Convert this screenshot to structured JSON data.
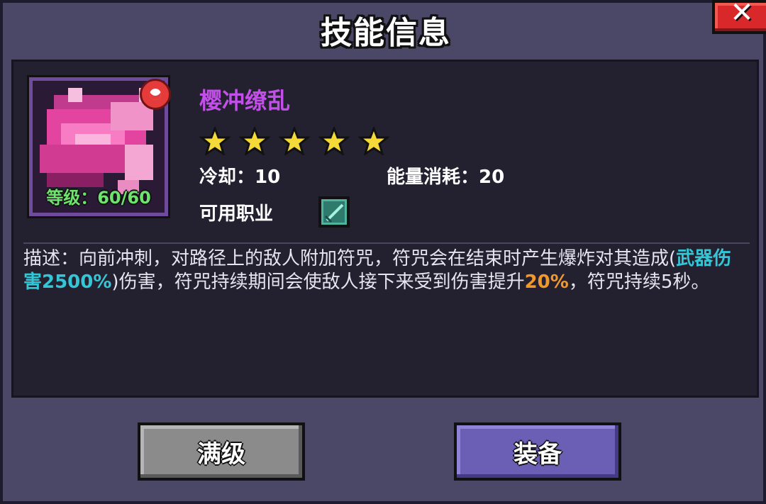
{
  "dialog": {
    "title": "技能信息",
    "close_label": "✕"
  },
  "skill": {
    "name": "樱冲缭乱",
    "name_color": "#c24fe8",
    "level_text": "等级：60/60",
    "star_count": 5,
    "cooldown_text": "冷却：10",
    "energy_text": "能量消耗：20",
    "class_label": "可用职业",
    "class_icon": "sword-class-icon"
  },
  "description": {
    "part1": "描述：向前冲刺，对路径上的敌人附加符咒，符咒会在结束时产生爆炸对其造成(",
    "highlight1": "武器伤害2500%",
    "part2": ")伤害，符咒持续期间会使敌人接下来受到伤害提升",
    "highlight2": "20%",
    "part3": "，符咒持续5秒。",
    "highlight1_color": "#35c6d6",
    "highlight2_color": "#f0982e"
  },
  "buttons": {
    "max_level": "满级",
    "equip": "装备"
  }
}
